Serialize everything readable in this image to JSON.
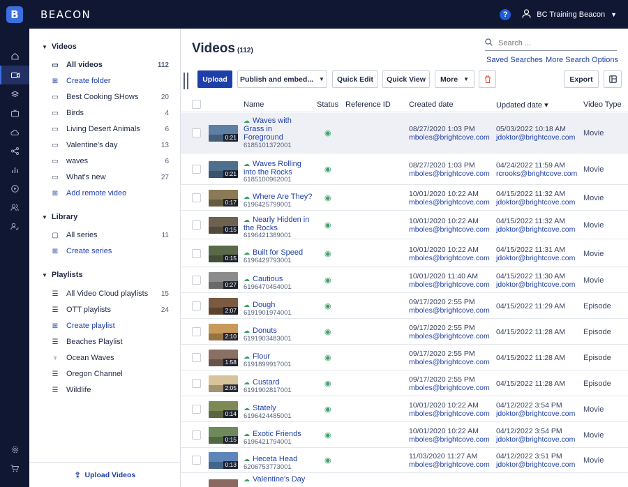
{
  "app": {
    "brand": "BEACON",
    "user_name": "BC Training Beacon",
    "help_label": "?"
  },
  "sidebar": {
    "sections": [
      {
        "label": "Videos"
      },
      {
        "label": "Library"
      },
      {
        "label": "Playlists"
      }
    ],
    "videos": [
      {
        "label": "All videos",
        "count": "112",
        "icon": "video-camera-icon"
      },
      {
        "label": "Create folder",
        "icon": "plus-box-icon"
      },
      {
        "label": "Best Cooking SHows",
        "count": "20",
        "icon": "folder-icon"
      },
      {
        "label": "Birds",
        "count": "4",
        "icon": "folder-icon"
      },
      {
        "label": "Living Desert Animals",
        "count": "6",
        "icon": "folder-icon"
      },
      {
        "label": "Valentine's day",
        "count": "13",
        "icon": "folder-icon"
      },
      {
        "label": "waves",
        "count": "6",
        "icon": "folder-icon"
      },
      {
        "label": "What's new",
        "count": "27",
        "icon": "folder-icon"
      },
      {
        "label": "Add remote video",
        "icon": "plus-box-icon"
      }
    ],
    "library": [
      {
        "label": "All series",
        "count": "11",
        "icon": "series-icon"
      },
      {
        "label": "Create series",
        "icon": "plus-box-icon"
      }
    ],
    "playlists": [
      {
        "label": "All Video Cloud playlists",
        "count": "15",
        "icon": "list-icon"
      },
      {
        "label": "OTT playlists",
        "count": "24",
        "icon": "list-icon"
      },
      {
        "label": "Create playlist",
        "icon": "plus-box-icon"
      },
      {
        "label": "Beaches Playlist",
        "icon": "list-icon"
      },
      {
        "label": "Ocean Waves",
        "icon": "smart-playlist-icon"
      },
      {
        "label": "Oregon Channel",
        "icon": "list-icon"
      },
      {
        "label": "Wildlife",
        "icon": "list-icon"
      }
    ],
    "footer_label": "Upload Videos"
  },
  "main": {
    "title": "Videos",
    "count": "(112)",
    "search_placeholder": "Search ...",
    "saved_searches": "Saved Searches",
    "more_search_options": "More Search Options",
    "toolbar": {
      "upload": "Upload",
      "publish": "Publish and embed...",
      "quick_edit": "Quick Edit",
      "quick_view": "Quick View",
      "more": "More",
      "export": "Export"
    },
    "columns": {
      "name": "Name",
      "status": "Status",
      "reference_id": "Reference ID",
      "created": "Created date",
      "updated": "Updated date ▾",
      "type": "Video Type"
    },
    "rows": [
      {
        "name": "Waves with Grass in Foreground",
        "id": "6185101372001",
        "duration": "0:21",
        "created": "08/27/2020 1:03 PM",
        "created_by": "mboles@brightcove.com",
        "updated": "05/03/2022 10:18 AM",
        "updated_by": "jdoktor@brightcove.com",
        "type": "Movie",
        "thumb": "#5d7fa3"
      },
      {
        "name": "Waves Rolling into the Rocks",
        "id": "6185100962001",
        "duration": "0:21",
        "created": "08/27/2020 1:03 PM",
        "created_by": "mboles@brightcove.com",
        "updated": "04/24/2022 11:59 AM",
        "updated_by": "rcrooks@brightcove.com",
        "type": "Movie",
        "thumb": "#4f6f8e"
      },
      {
        "name": "Where Are They?",
        "id": "6196425799001",
        "duration": "0:17",
        "created": "10/01/2020 10:22 AM",
        "created_by": "mboles@brightcove.com",
        "updated": "04/15/2022 11:32 AM",
        "updated_by": "jdoktor@brightcove.com",
        "type": "Movie",
        "thumb": "#8a7a55"
      },
      {
        "name": "Nearly Hidden in the Rocks",
        "id": "6196421389001",
        "duration": "0:15",
        "created": "10/01/2020 10:22 AM",
        "created_by": "mboles@brightcove.com",
        "updated": "04/15/2022 11:32 AM",
        "updated_by": "jdoktor@brightcove.com",
        "type": "Movie",
        "thumb": "#6d6250"
      },
      {
        "name": "Built for Speed",
        "id": "6196429793001",
        "duration": "0:15",
        "created": "10/01/2020 10:22 AM",
        "created_by": "mboles@brightcove.com",
        "updated": "04/15/2022 11:31 AM",
        "updated_by": "jdoktor@brightcove.com",
        "type": "Movie",
        "thumb": "#5a6a48"
      },
      {
        "name": "Cautious",
        "id": "6196470454001",
        "duration": "0:27",
        "created": "10/01/2020 11:40 AM",
        "created_by": "mboles@brightcove.com",
        "updated": "04/15/2022 11:30 AM",
        "updated_by": "jdoktor@brightcove.com",
        "type": "Movie",
        "thumb": "#8c8c8c"
      },
      {
        "name": "Dough",
        "id": "6191901974001",
        "duration": "2:07",
        "created": "09/17/2020 2:55 PM",
        "created_by": "mboles@brightcove.com",
        "updated": "04/15/2022 11:29 AM",
        "updated_by": "",
        "type": "Episode",
        "thumb": "#7a5a40"
      },
      {
        "name": "Donuts",
        "id": "6191903483001",
        "duration": "2:10",
        "created": "09/17/2020 2:55 PM",
        "created_by": "mboles@brightcove.com",
        "updated": "04/15/2022 11:28 AM",
        "updated_by": "",
        "type": "Episode",
        "thumb": "#c89a5a"
      },
      {
        "name": "Flour",
        "id": "6191899917001",
        "duration": "1:58",
        "created": "09/17/2020 2:55 PM",
        "created_by": "mboles@brightcove.com",
        "updated": "04/15/2022 11:28 AM",
        "updated_by": "",
        "type": "Episode",
        "thumb": "#8a6f63"
      },
      {
        "name": "Custard",
        "id": "6191902817001",
        "duration": "2:05",
        "created": "09/17/2020 2:55 PM",
        "created_by": "mboles@brightcove.com",
        "updated": "04/15/2022 11:28 AM",
        "updated_by": "",
        "type": "Episode",
        "thumb": "#d8c49a"
      },
      {
        "name": "Stately",
        "id": "6196424485001",
        "duration": "0:14",
        "created": "10/01/2020 10:22 AM",
        "created_by": "mboles@brightcove.com",
        "updated": "04/12/2022 3:54 PM",
        "updated_by": "jdoktor@brightcove.com",
        "type": "Movie",
        "thumb": "#7d8a55"
      },
      {
        "name": "Exotic Friends",
        "id": "6196421794001",
        "duration": "0:15",
        "created": "10/01/2020 10:22 AM",
        "created_by": "mboles@brightcove.com",
        "updated": "04/12/2022 3:54 PM",
        "updated_by": "jdoktor@brightcove.com",
        "type": "Movie",
        "thumb": "#6e8a5a"
      },
      {
        "name": "Heceta Head",
        "id": "6206753773001",
        "duration": "0:13",
        "created": "11/03/2020 11:27 AM",
        "created_by": "mboles@brightcove.com",
        "updated": "04/12/2022 3:51 PM",
        "updated_by": "jdoktor@brightcove.com",
        "type": "Movie",
        "thumb": "#5d86b8"
      },
      {
        "name": "Valentine's Day",
        "id": "",
        "duration": "",
        "created": "",
        "created_by": "",
        "updated": "",
        "updated_by": "",
        "type": "",
        "thumb": "#8a6a60"
      }
    ]
  },
  "colors": {
    "nav_bg": "#101733",
    "accent": "#1f3fa8",
    "status_ok": "#3aa06a",
    "danger": "#d94a3a"
  }
}
